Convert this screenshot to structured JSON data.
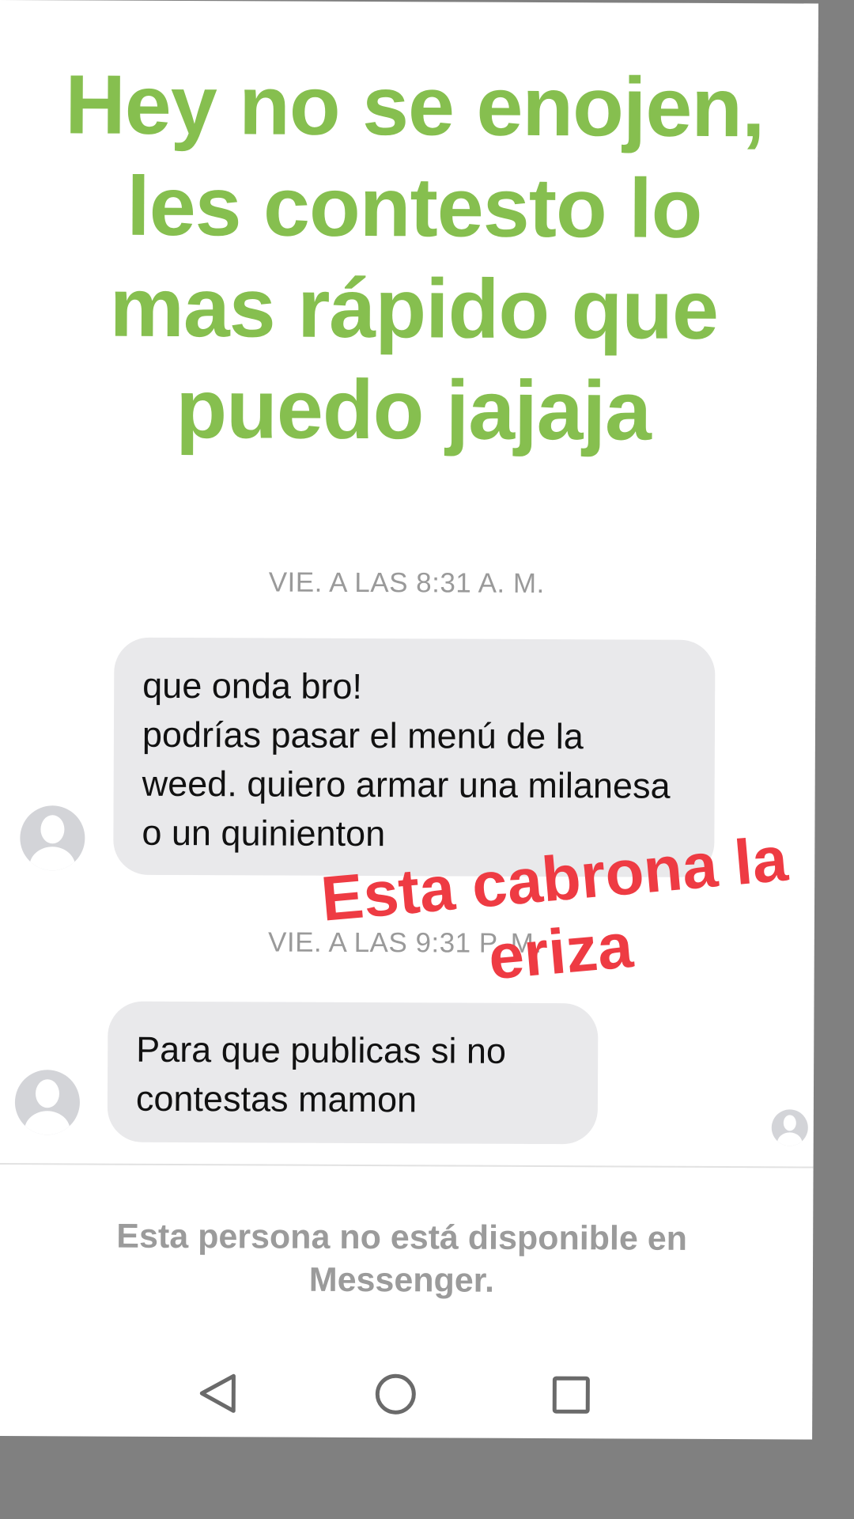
{
  "headline": "Hey no se enojen, les contesto lo mas rápido que puedo jajaja",
  "overlay_caption": "Esta cabrona la eriza",
  "chat": {
    "messages": [
      {
        "timestamp": "VIE. A LAS 8:31 A. M.",
        "text": "que onda bro!\npodrías pasar el menú de la weed. quiero armar una milanesa o un quinienton"
      },
      {
        "timestamp": "VIE. A LAS 9:31 P. M.",
        "text": "Para que publicas si no contestas mamon"
      }
    ]
  },
  "footer_notice": "Esta persona no está disponible en Messenger.",
  "colors": {
    "headline": "#86bf4f",
    "overlay": "#ee3b43",
    "bubble": "#e9e9eb",
    "muted_text": "#9b9b9b"
  },
  "navbar": {
    "buttons": [
      "back-icon",
      "home-icon",
      "recent-apps-icon"
    ]
  }
}
